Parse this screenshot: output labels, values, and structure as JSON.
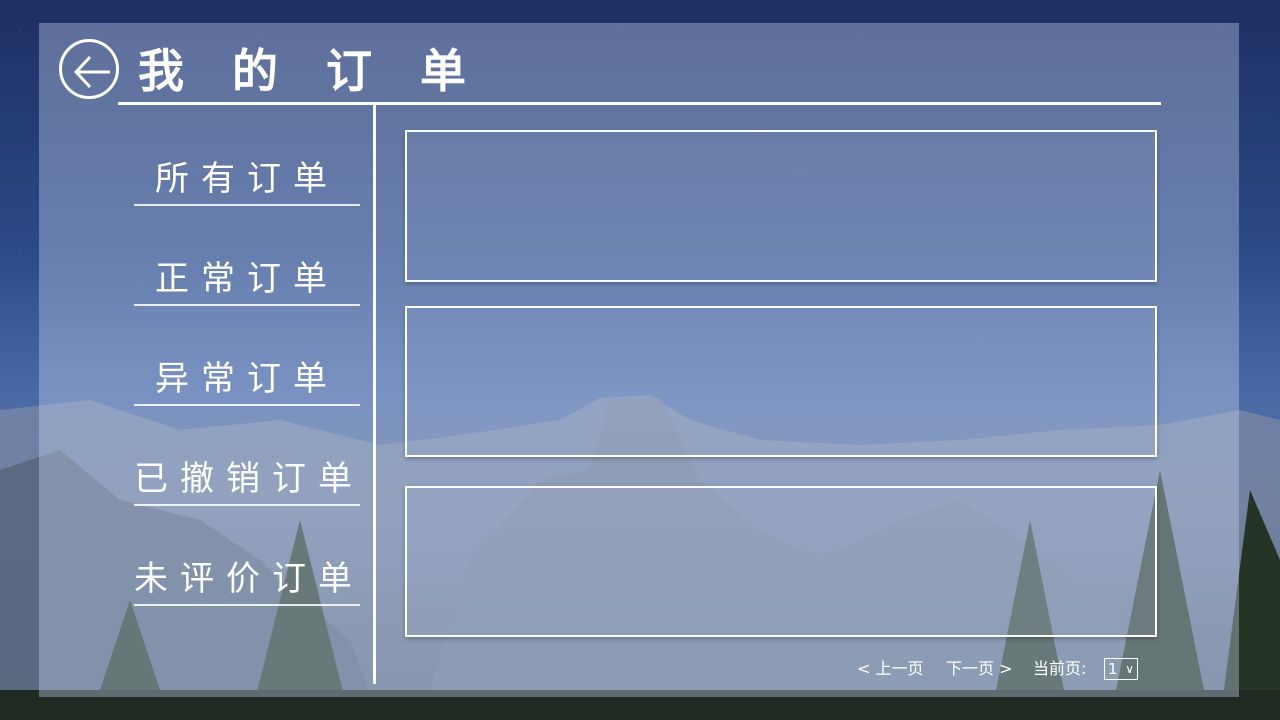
{
  "header": {
    "title": "我 的 订 单"
  },
  "sidebar": {
    "items": [
      {
        "label": "所有订单"
      },
      {
        "label": "正常订单"
      },
      {
        "label": "异常订单"
      },
      {
        "label": "已撤销订单"
      },
      {
        "label": "未评价订单"
      }
    ]
  },
  "pager": {
    "prev": "< 上一页",
    "next": "下一页 >",
    "current_label": "当前页:",
    "current_value": "1",
    "caret": "∨"
  },
  "colors": {
    "text": "#ffffff",
    "panel_tint": "rgba(200,212,240,0.38)",
    "sky_top": "#1d2f63"
  },
  "icons": {
    "back": "arrow-left-circle-icon",
    "select": "chevron-down-icon"
  }
}
